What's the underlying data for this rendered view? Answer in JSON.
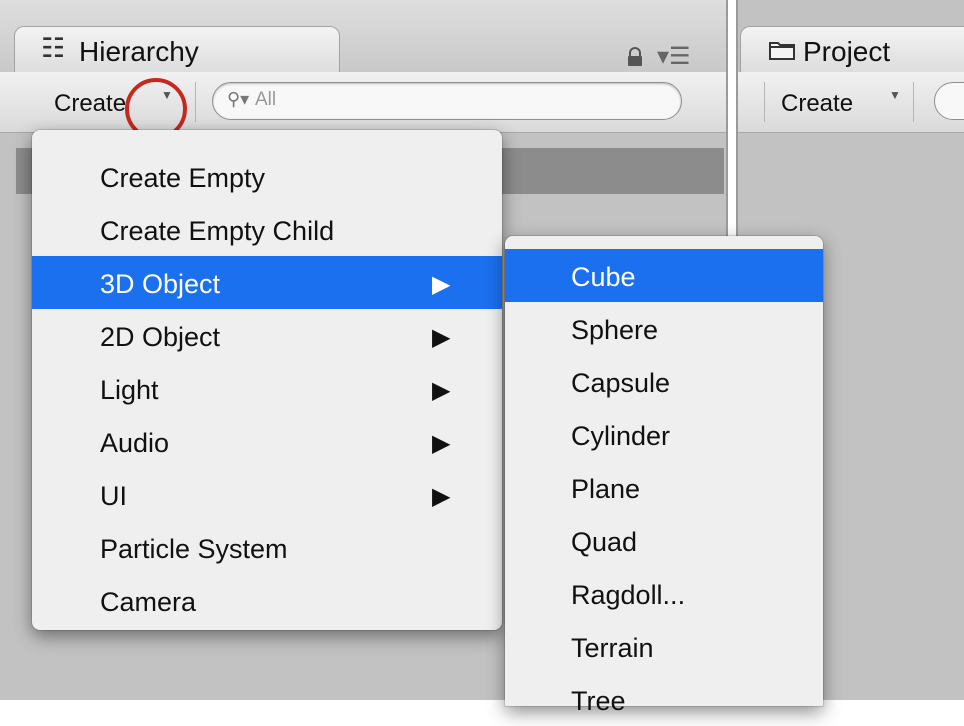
{
  "hierarchy": {
    "tab_icon": "list-icon",
    "tab_label": "Hierarchy",
    "create_label": "Create",
    "create_arrow": "▼",
    "search_icon": "search-dropdown-icon",
    "search_placeholder": "All",
    "lock_icon": "lock-icon",
    "menu_icon": "tab-menu-icon"
  },
  "project": {
    "tab_icon": "folder-icon",
    "tab_label": "Project",
    "create_label": "Create",
    "create_arrow": "▼"
  },
  "create_menu": {
    "items": [
      {
        "label": "Create Empty",
        "submenu": false
      },
      {
        "label": "Create Empty Child",
        "submenu": false
      },
      {
        "label": "3D Object",
        "submenu": true,
        "highlighted": true
      },
      {
        "label": "2D Object",
        "submenu": true
      },
      {
        "label": "Light",
        "submenu": true
      },
      {
        "label": "Audio",
        "submenu": true
      },
      {
        "label": "UI",
        "submenu": true
      },
      {
        "label": "Particle System",
        "submenu": false
      },
      {
        "label": "Camera",
        "submenu": false
      }
    ],
    "submenu_arrow": "▶"
  },
  "submenu_3d": {
    "items": [
      "Cube",
      "Sphere",
      "Capsule",
      "Cylinder",
      "Plane",
      "Quad",
      "Ragdoll...",
      "Terrain",
      "Tree"
    ],
    "highlighted_index": 0
  },
  "colors": {
    "highlight": "#1b70f0",
    "annotation_circle": "#c6281e"
  }
}
